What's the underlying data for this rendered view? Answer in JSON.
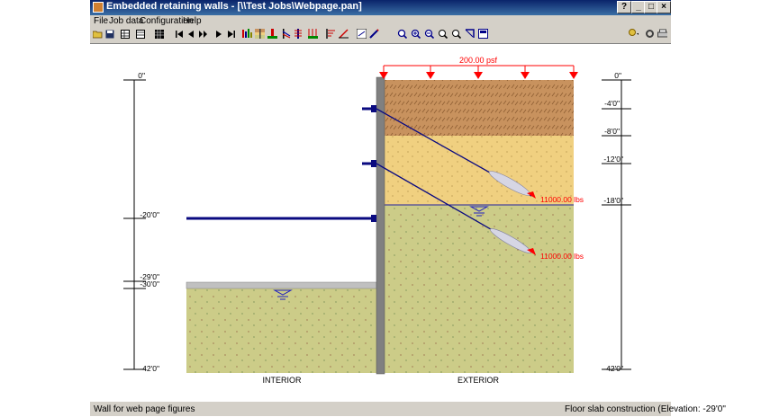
{
  "window": {
    "title": "Embedded retaining walls - [\\\\Test Jobs\\Webpage.pan]"
  },
  "menu": [
    "File",
    "Job data",
    "Configuration",
    "Help"
  ],
  "titlebar_buttons": [
    "?",
    "_",
    "□",
    "×"
  ],
  "toolbar_icons": [
    "open-icon",
    "save-icon",
    "grid-icon",
    "table-icon",
    "data-icon",
    "first-icon",
    "prev-icon",
    "play-icon",
    "next-icon",
    "last-icon",
    "bars-icon",
    "layers-icon",
    "wall-icon",
    "anchor-icon",
    "pile-icon",
    "surcharge-icon",
    "loads-icon",
    "chart-icon",
    "section-icon",
    "pen-icon",
    "zoom-fit-icon",
    "zoom-in-icon",
    "zoom-out-icon",
    "zoom-window-icon",
    "pan-icon",
    "reset-icon",
    "print-icon",
    "help-pointer-icon",
    "settings-icon",
    "print-icon"
  ],
  "drawing": {
    "surcharge": "200.00 psf",
    "left_scale": [
      "0\"",
      "-20'0\"",
      "-29'0\"",
      "-30'0\"",
      "-42'0\""
    ],
    "right_scale": [
      "0\"",
      "-4'0\"",
      "-8'0\"",
      "-12'0\"",
      "-18'0\"",
      "-42'0\""
    ],
    "anchor_loads": [
      "11000.00 lbs",
      "11000.00 lbs"
    ],
    "labels": {
      "interior": "INTERIOR",
      "exterior": "EXTERIOR"
    },
    "colors": {
      "top_layer": "#c8925e",
      "middle_layer": "#f0d080",
      "bottom_layer": "#cccc88",
      "wall": "#808080",
      "anchor": "#0a0a80",
      "load": "#ff0000"
    }
  },
  "status": {
    "left": "Wall for web page figures",
    "right": "Floor slab construction (Elevation: -29'0\""
  }
}
